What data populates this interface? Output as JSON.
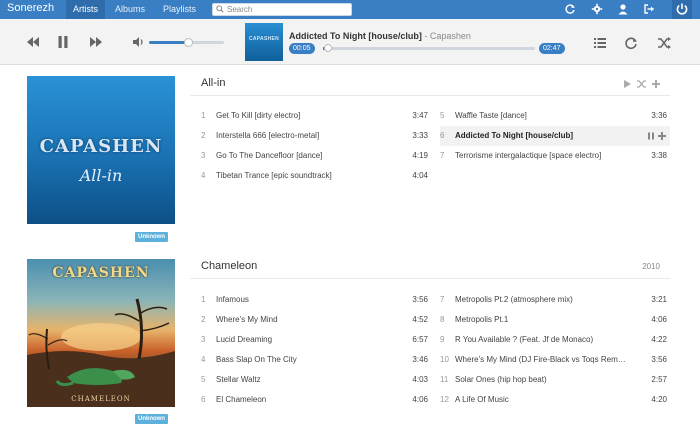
{
  "app": {
    "brand": "Sonerezh"
  },
  "nav": {
    "tabs": [
      {
        "label": "Artists"
      },
      {
        "label": "Albums"
      },
      {
        "label": "Playlists"
      }
    ]
  },
  "search": {
    "placeholder": "Search"
  },
  "player": {
    "now_playing": {
      "title": "Addicted To Night [house/club]",
      "artist": "Capashen",
      "art_text": "CAPASHEN"
    },
    "elapsed": "00:05",
    "duration": "02:47",
    "progress": 0.012,
    "volume": 0.52
  },
  "albums": [
    {
      "title": "All-in",
      "year": "",
      "badge": "Unknown",
      "cover_band": "CAPASHEN",
      "cover_sub": "All-in",
      "tracks": [
        {
          "num": "1",
          "title": "Get To Kill [dirty electro]",
          "duration": "3:47"
        },
        {
          "num": "2",
          "title": "Interstella 666 [electro-metal]",
          "duration": "3:33"
        },
        {
          "num": "3",
          "title": "Go To The Dancefloor [dance]",
          "duration": "4:19"
        },
        {
          "num": "4",
          "title": "Tibetan Trance [epic soundtrack]",
          "duration": "4:04"
        },
        {
          "num": "5",
          "title": "Waffle Taste [dance]",
          "duration": "3:36"
        },
        {
          "num": "6",
          "title": "Addicted To Night [house/club]",
          "duration": "",
          "playing": true
        },
        {
          "num": "7",
          "title": "Terrorisme intergalactique [space electro]",
          "duration": "3:38"
        }
      ]
    },
    {
      "title": "Chameleon",
      "year": "2010",
      "badge": "Unknown",
      "cover_band": "CAPASHEN",
      "cover_sub": "CHAMELEON",
      "tracks": [
        {
          "num": "1",
          "title": "Infamous",
          "duration": "3:56"
        },
        {
          "num": "2",
          "title": "Where's My Mind",
          "duration": "4:52"
        },
        {
          "num": "3",
          "title": "Lucid Dreaming",
          "duration": "6:57"
        },
        {
          "num": "4",
          "title": "Bass Slap On The City",
          "duration": "3:46"
        },
        {
          "num": "5",
          "title": "Stellar Waltz",
          "duration": "4:03"
        },
        {
          "num": "6",
          "title": "El Chameleon",
          "duration": "4:06"
        },
        {
          "num": "7",
          "title": "Metropolis Pt.2 (atmosphere mix)",
          "duration": "3:21"
        },
        {
          "num": "8",
          "title": "Metropolis Pt.1",
          "duration": "4:06"
        },
        {
          "num": "9",
          "title": "R You Available ? (Feat. Jf de Monaco)",
          "duration": "4:22"
        },
        {
          "num": "10",
          "title": "Where's My Mind (DJ Fire-Black vs Toqs Rem…",
          "duration": "3:56"
        },
        {
          "num": "11",
          "title": "Solar Ones (hip hop beat)",
          "duration": "2:57"
        },
        {
          "num": "12",
          "title": "A Life Of Music",
          "duration": "4:20"
        }
      ]
    }
  ],
  "icons": [
    "refresh-icon",
    "gear-icon",
    "user-icon",
    "logout-icon",
    "power-icon",
    "previous-icon",
    "pause-icon",
    "next-icon",
    "volume-icon",
    "queue-icon",
    "repeat-icon",
    "shuffle-icon",
    "play-icon",
    "plus-icon",
    "search-icon"
  ],
  "colors": {
    "accent": "#3a7ec4",
    "topbar": "#3a7ec4",
    "badge": "#5bb1dc"
  }
}
